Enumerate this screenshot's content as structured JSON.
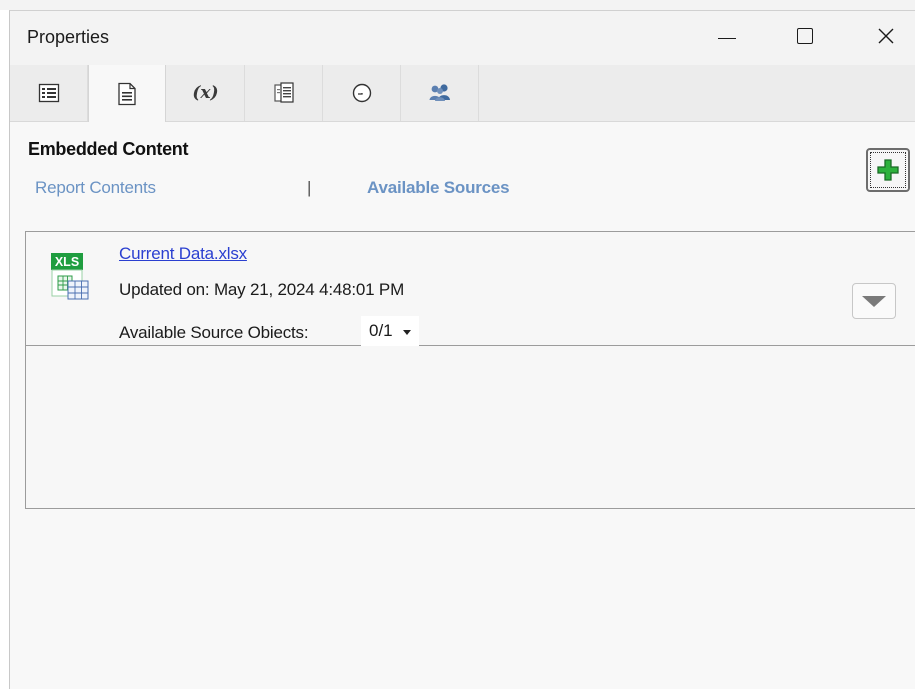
{
  "window": {
    "title": "Properties"
  },
  "tabs": [
    {
      "name": "list",
      "icon": "list-view-icon"
    },
    {
      "name": "page",
      "icon": "document-icon",
      "active": true
    },
    {
      "name": "variables",
      "icon": "variable-icon",
      "label": "(x)"
    },
    {
      "name": "data",
      "icon": "data-doc-icon"
    },
    {
      "name": "schedule",
      "icon": "clock-icon"
    },
    {
      "name": "users",
      "icon": "users-icon"
    }
  ],
  "content": {
    "section_title": "Embedded Content",
    "report_contents_link": "Report Contents",
    "separator": "|",
    "available_sources_link": "Available Sources",
    "add_button_icon": "green-plus-icon"
  },
  "source_item": {
    "icon_label": "XLS",
    "file_name": "Current Data.xlsx",
    "updated": "Updated on: May 21, 2024 4:48:01 PM",
    "objects_label": "Available Source Obiects:",
    "objects_value": "0/1"
  },
  "colors": {
    "link": "#6b93c4",
    "file_link": "#2a3fd0",
    "xls_green": "#1f9d3f",
    "plus_green": "#2db13c"
  }
}
